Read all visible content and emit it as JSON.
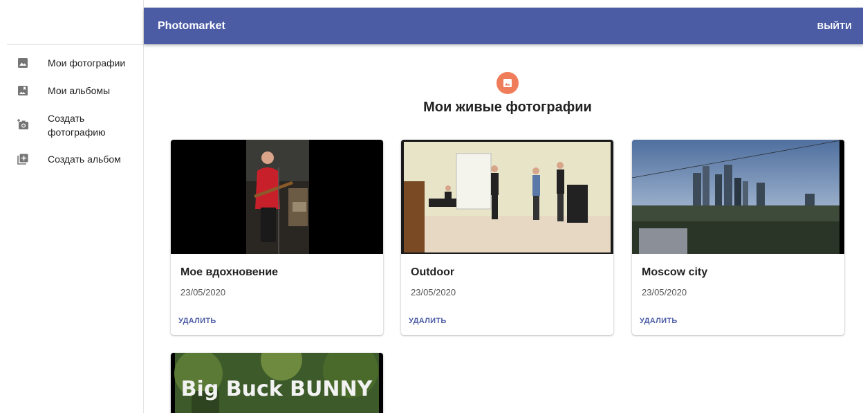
{
  "app": {
    "title": "Photomarket",
    "logout_label": "ВЫЙТИ"
  },
  "sidebar": {
    "items": [
      {
        "label": "Мои фотографии",
        "icon": "image-icon"
      },
      {
        "label": "Мои альбомы",
        "icon": "album-icon"
      },
      {
        "label": "Создать фотографию",
        "icon": "add-photo-icon"
      },
      {
        "label": "Создать альбом",
        "icon": "add-box-icon"
      }
    ]
  },
  "main": {
    "title": "Мои живые фотографии",
    "header_icon": "photo-icon",
    "header_icon_color": "#ef7d5a",
    "cards": [
      {
        "name": "Мое вдохновение",
        "date": "23/05/2020",
        "delete_label": "УДАЛИТЬ"
      },
      {
        "name": "Outdoor",
        "date": "23/05/2020",
        "delete_label": "УДАЛИТЬ"
      },
      {
        "name": "Moscow city",
        "date": "23/05/2020",
        "delete_label": "УДАЛИТЬ"
      },
      {
        "thumb_text": "Big Buck BUNNY"
      }
    ]
  },
  "colors": {
    "primary": "#4b5ca5",
    "accent": "#ef7d5a"
  }
}
